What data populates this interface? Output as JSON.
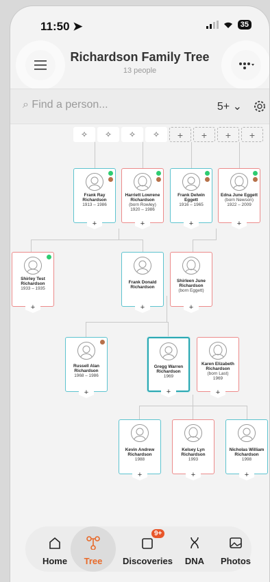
{
  "status": {
    "time": "11:50",
    "battery": "35"
  },
  "header": {
    "title": "Richardson Family Tree",
    "subtitle": "13 people"
  },
  "search": {
    "placeholder": "Find a person...",
    "generations": "5+"
  },
  "people": {
    "frank_ray": {
      "name": "Frank Ray Richardson",
      "dates": "1913 – 1986"
    },
    "harriett": {
      "name": "Harriett Lowrene Richardson",
      "born": "(born Rowley)",
      "dates": "1920 – 1986"
    },
    "frank_delwin": {
      "name": "Frank Delwin Eggett",
      "dates": "1916 – 1965"
    },
    "edna": {
      "name": "Edna June Eggett",
      "born": "(born Newson)",
      "dates": "1922 – 2009"
    },
    "shirley_test": {
      "name": "Shirley Test Richardson",
      "dates": "1933 – 1935"
    },
    "frank_donald": {
      "name": "Frank Donald Richardson"
    },
    "shirleen": {
      "name": "Shirleen June Richardson",
      "born": "(born Eggett)"
    },
    "russell": {
      "name": "Russell Alan Richardson",
      "dates": "1968 – 1986"
    },
    "gregg": {
      "name": "Gregg Warren Richardson",
      "dates": "1969"
    },
    "karen": {
      "name": "Karen Elizabeth Richardson",
      "born": "(born Last)",
      "dates": "1969"
    },
    "kevin": {
      "name": "Kevin Andrew Richardson",
      "dates": "1988"
    },
    "kelsey": {
      "name": "Kelsey Lyn Richardson",
      "dates": "1993"
    },
    "nicholas": {
      "name": "Nicholas William Richardson",
      "dates": "1998"
    }
  },
  "plus": "+",
  "tabs": [
    {
      "label": "Home"
    },
    {
      "label": "Tree"
    },
    {
      "label": "Discoveries",
      "badge": "9+"
    },
    {
      "label": "DNA"
    },
    {
      "label": "Photos"
    }
  ],
  "colors": {
    "male": "#5cc3cf",
    "female": "#ec8a8a",
    "accent": "#e86a2a"
  }
}
